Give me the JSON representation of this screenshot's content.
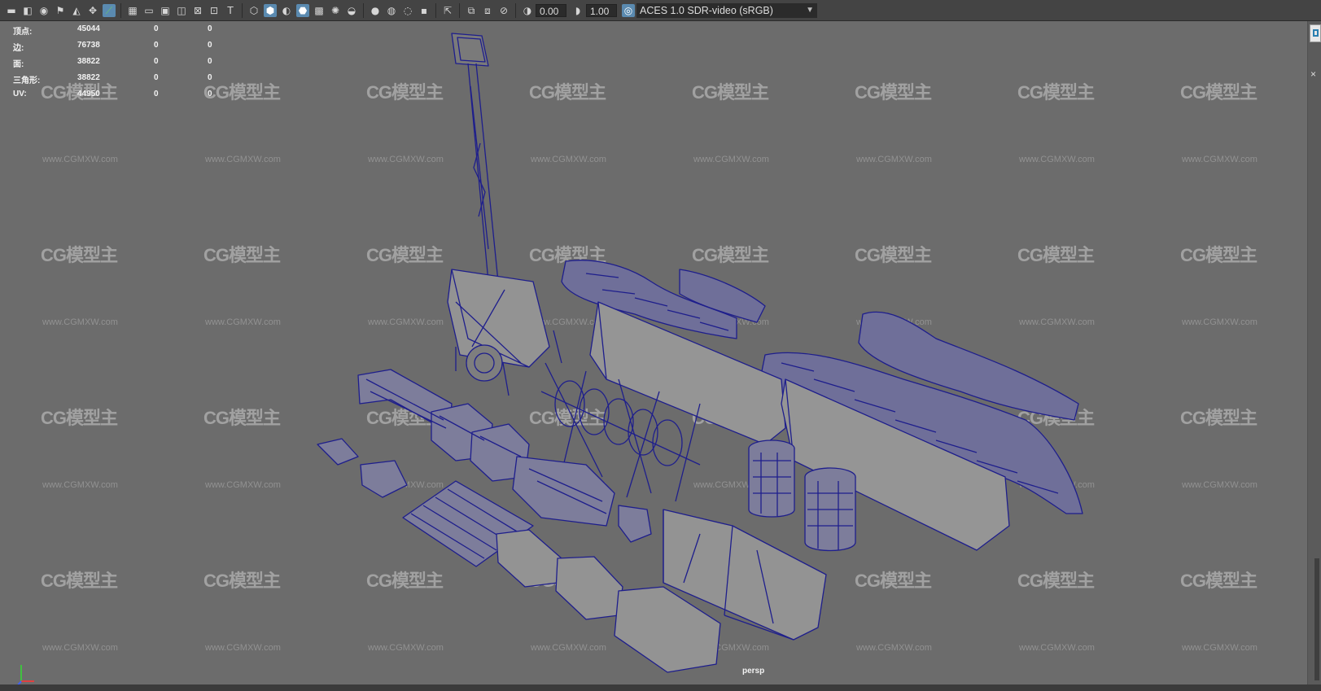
{
  "toolbar": {
    "exposure_value": "0.00",
    "gamma_value": "1.00",
    "color_space": "ACES 1.0 SDR-video (sRGB)",
    "icons": [
      "camera-icon",
      "camera-attr-icon",
      "bookmark-icon",
      "image-plane-icon",
      "grid-icon",
      "film-gate-icon",
      "resolution-gate-icon",
      "safe-action-icon",
      "wireframe-icon",
      "smooth-shade-icon",
      "default-material-icon",
      "textured-icon",
      "lights-icon",
      "shadows-icon",
      "ambient-occlusion-icon",
      "isolate-icon",
      "xray-icon",
      "exposure-icon",
      "gamma-icon",
      "color-management-icon"
    ]
  },
  "hud": {
    "rows": [
      {
        "label": "顶点:",
        "values": [
          "45044",
          "0",
          "0"
        ]
      },
      {
        "label": "边:",
        "values": [
          "76738",
          "0",
          "0"
        ]
      },
      {
        "label": "面:",
        "values": [
          "38822",
          "0",
          "0"
        ]
      },
      {
        "label": "三角形:",
        "values": [
          "38822",
          "0",
          "0"
        ]
      },
      {
        "label": "UV:",
        "values": [
          "44950",
          "0",
          "0"
        ]
      }
    ]
  },
  "viewport": {
    "camera_label": "persp",
    "watermark_text": "CG模型主",
    "watermark_url": "www.CGMXW.com",
    "background_color": "#6c6c6c",
    "wire_color": "#1e1e8c",
    "mesh_color": "#8c8c8c",
    "axis_colors": {
      "x": "#e04040",
      "y": "#40c040",
      "z": "#4060ff"
    }
  }
}
